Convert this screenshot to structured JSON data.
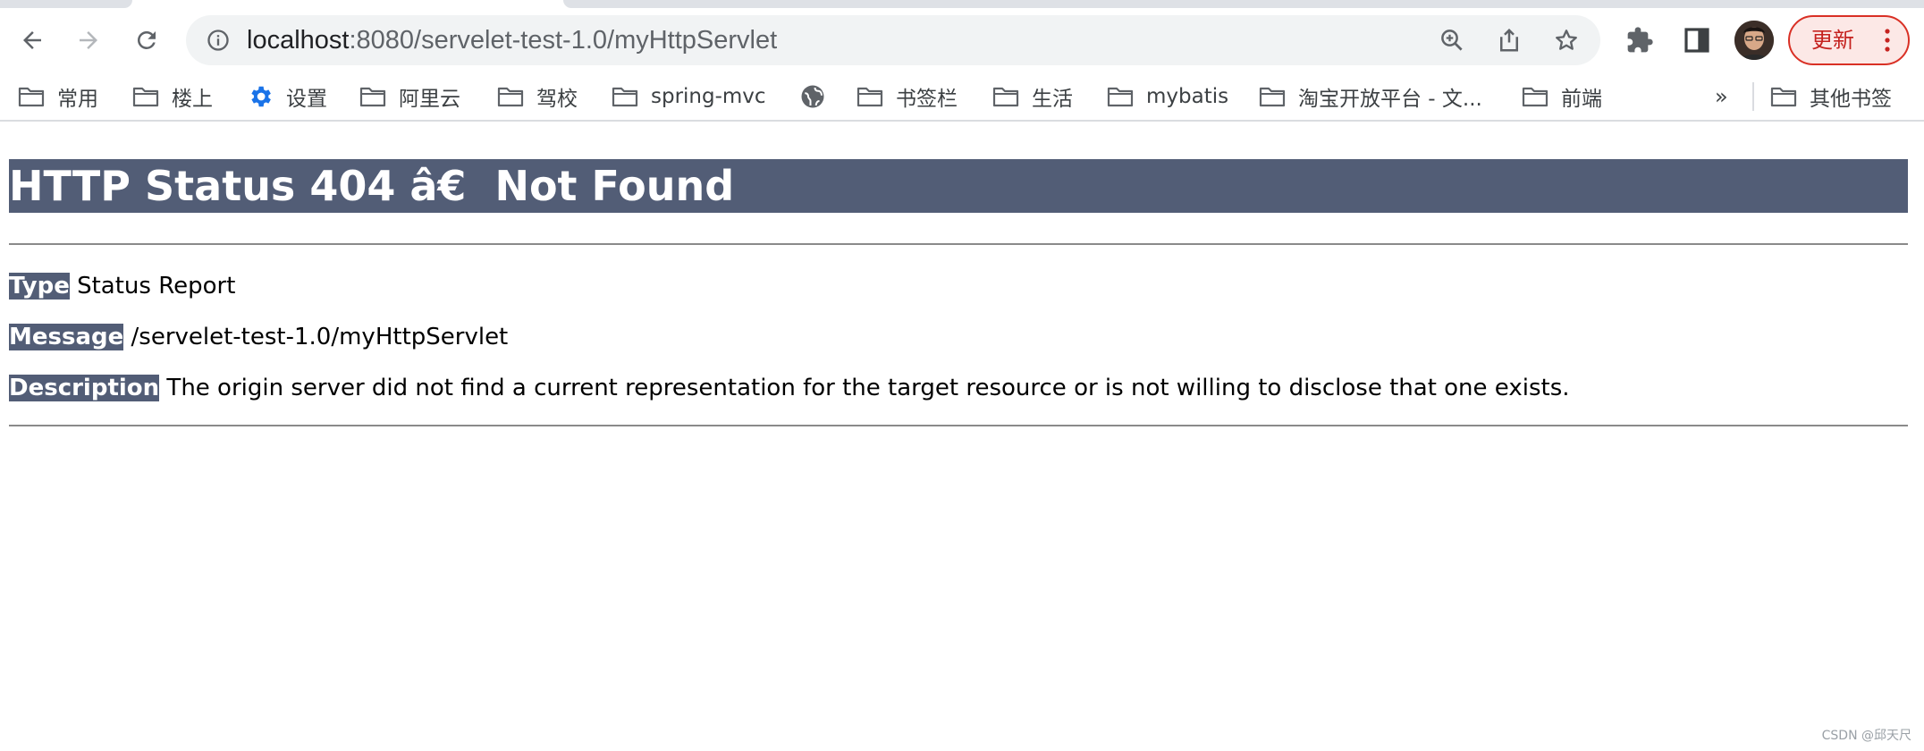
{
  "browser": {
    "url_host": "localhost",
    "url_path": ":8080/servelet-test-1.0/myHttpServlet",
    "update_label": "更新",
    "icons": {
      "back": "arrow-left-icon",
      "forward": "arrow-right-icon",
      "reload": "reload-icon",
      "site_info": "info-icon",
      "zoom": "zoom-in-icon",
      "share": "share-icon",
      "bookmark": "star-icon",
      "extensions": "puzzle-icon",
      "side_panel": "side-panel-icon",
      "menu": "more-vert-icon"
    }
  },
  "bookmarks": {
    "items": [
      {
        "label": "常用",
        "icon": "folder-icon"
      },
      {
        "label": "楼上",
        "icon": "folder-icon"
      },
      {
        "label": "设置",
        "icon": "gear-icon"
      },
      {
        "label": "阿里云",
        "icon": "folder-icon"
      },
      {
        "label": "驾校",
        "icon": "folder-icon"
      },
      {
        "label": "spring-mvc",
        "icon": "folder-icon"
      },
      {
        "label": "",
        "icon": "globe-icon"
      },
      {
        "label": "书签栏",
        "icon": "folder-icon"
      },
      {
        "label": "生活",
        "icon": "folder-icon"
      },
      {
        "label": "mybatis",
        "icon": "folder-icon"
      },
      {
        "label": "淘宝开放平台 - 文...",
        "icon": "folder-icon"
      },
      {
        "label": "前端",
        "icon": "folder-icon"
      }
    ],
    "overflow": "»",
    "other": "其他书签"
  },
  "page": {
    "title": "HTTP Status 404 â€  Not Found",
    "type_label": "Type",
    "type_value": " Status Report",
    "message_label": "Message",
    "message_value": " /servelet-test-1.0/myHttpServlet",
    "description_label": "Description",
    "description_value": " The origin server did not find a current representation for the target resource or is not willing to disclose that one exists."
  },
  "colors": {
    "header_bg": "#525d76",
    "update_bg": "#fce8e6",
    "update_text": "#c5221f",
    "omnibox_bg": "#f1f3f4"
  },
  "watermark": "CSDN @邱天尺"
}
